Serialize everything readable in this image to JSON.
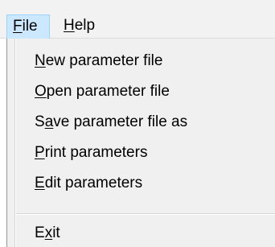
{
  "menubar": {
    "file": {
      "mnemonic": "F",
      "rest": "ile"
    },
    "help": {
      "mnemonic": "H",
      "rest": "elp"
    }
  },
  "file_menu": {
    "items": [
      {
        "mnemonic": "N",
        "rest": "ew parameter file"
      },
      {
        "mnemonic": "O",
        "rest": "pen parameter file"
      },
      {
        "before": "S",
        "mnemonic": "a",
        "rest": "ve parameter file as"
      },
      {
        "mnemonic": "P",
        "rest": "rint parameters"
      },
      {
        "mnemonic": "E",
        "rest": "dit parameters"
      }
    ],
    "exit": {
      "before": "E",
      "mnemonic": "x",
      "rest": "it"
    }
  }
}
